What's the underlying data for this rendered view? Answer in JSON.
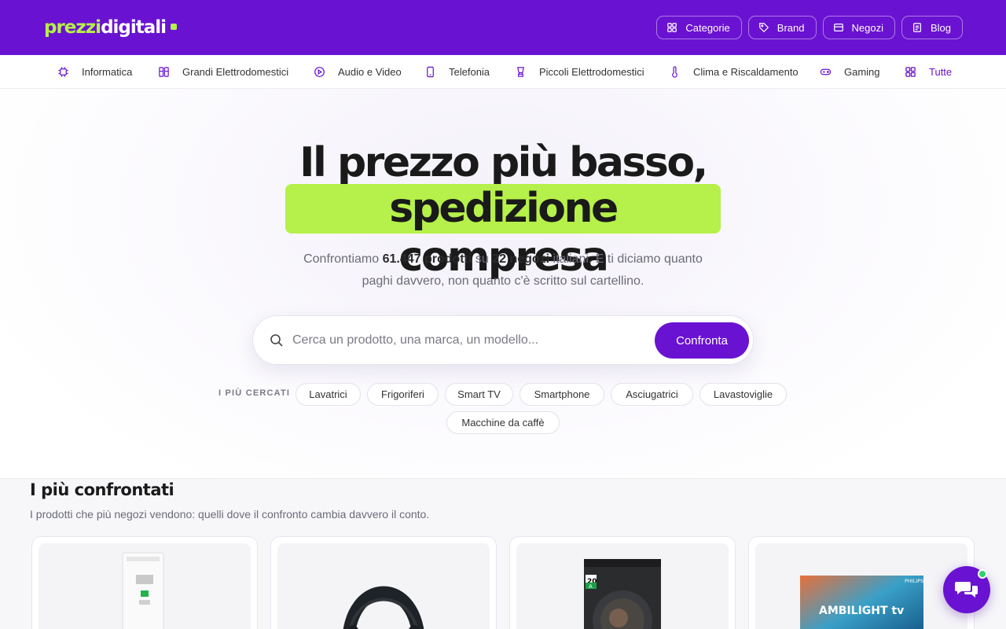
{
  "header": {
    "logo": {
      "part1": "prezzi",
      "part2": "digitali"
    },
    "nav": [
      {
        "label": "Categorie",
        "icon": "grid-icon"
      },
      {
        "label": "Brand",
        "icon": "tag-icon"
      },
      {
        "label": "Negozi",
        "icon": "store-icon"
      },
      {
        "label": "Blog",
        "icon": "document-icon"
      }
    ]
  },
  "categories": [
    {
      "label": "Informatica",
      "icon": "chip-icon"
    },
    {
      "label": "Grandi Elettrodomestici",
      "icon": "fridge-icon"
    },
    {
      "label": "Audio e Video",
      "icon": "play-icon"
    },
    {
      "label": "Telefonia",
      "icon": "phone-icon"
    },
    {
      "label": "Piccoli Elettrodomestici",
      "icon": "blender-icon"
    },
    {
      "label": "Clima e Riscaldamento",
      "icon": "thermometer-icon"
    },
    {
      "label": "Gaming",
      "icon": "gamepad-icon"
    },
    {
      "label": "Tutte",
      "icon": "grid-icon"
    }
  ],
  "hero": {
    "title_line1": "Il prezzo più basso,",
    "title_line2": "spedizione compresa",
    "subtitle": {
      "t1": "Confrontiamo ",
      "products_count": "61.447 prodotti",
      "t2": " su ",
      "stores_count": "22 negozi",
      "t3": " italiani. E ti diciamo quanto",
      "line2": "paghi davvero, non quanto c'è scritto sul cartellino."
    },
    "search": {
      "placeholder": "Cerca un prodotto, una marca, un modello...",
      "button": "Confronta"
    },
    "popular_label": "I PIÙ CERCATI",
    "popular": [
      "Lavatrici",
      "Frigoriferi",
      "Smart TV",
      "Smartphone",
      "Asciugatrici",
      "Lavastoviglie",
      "Macchine da caffè"
    ]
  },
  "section": {
    "title": "I più confrontati",
    "subtitle": "I prodotti che più negozi vendono: quelli dove il confronto cambia davvero il conto.",
    "tv_brand": "PHILIPS",
    "tv_label": "AMBILIGHT tv",
    "dryer_badge": "20",
    "dryer_class": "A"
  },
  "colors": {
    "brand": "#6a12d1",
    "accent": "#b6f04a"
  }
}
